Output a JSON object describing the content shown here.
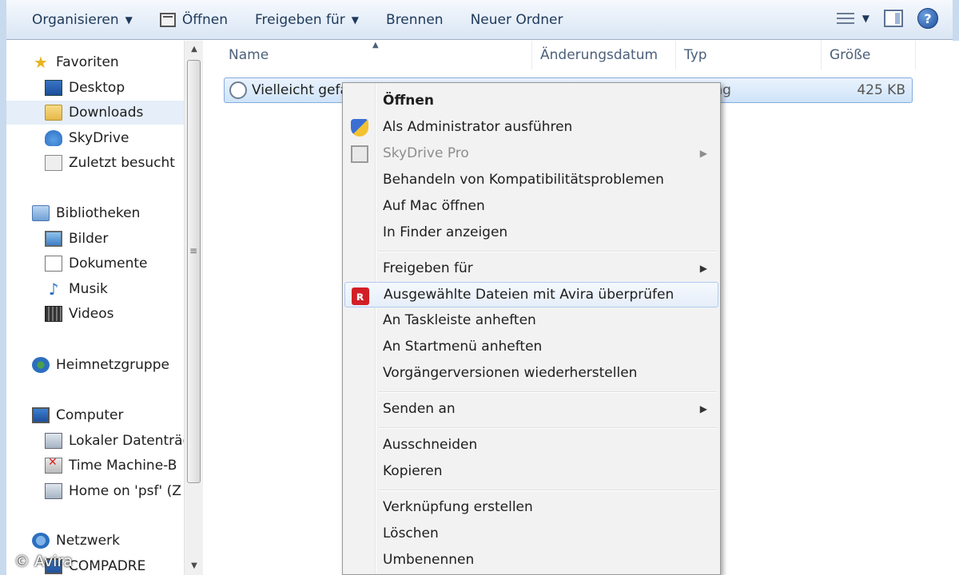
{
  "toolbar": {
    "organize": "Organisieren",
    "open": "Öffnen",
    "share": "Freigeben für",
    "burn": "Brennen",
    "new_folder": "Neuer Ordner",
    "help": "?"
  },
  "nav": {
    "favorites": "Favoriten",
    "desktop": "Desktop",
    "downloads": "Downloads",
    "skydrive": "SkyDrive",
    "recent": "Zuletzt besucht",
    "libraries": "Bibliotheken",
    "pictures": "Bilder",
    "documents": "Dokumente",
    "music": "Musik",
    "videos": "Videos",
    "homegroup": "Heimnetzgruppe",
    "computer": "Computer",
    "local_disk": "Lokaler Datenträg",
    "time_machine": "Time Machine-B",
    "home_psf": "Home on 'psf' (Z",
    "network": "Netzwerk",
    "compadre": "COMPADRE"
  },
  "columns": {
    "name": "Name",
    "date": "Änderungsdatum",
    "type": "Typ",
    "size": "Größe"
  },
  "file": {
    "name": "Vielleicht gefä",
    "type": "ndung",
    "size": "425 KB"
  },
  "menu": {
    "open": "Öffnen",
    "run_admin": "Als Administrator ausführen",
    "skydrive_pro": "SkyDrive Pro",
    "compat": "Behandeln von Kompatibilitätsproblemen",
    "open_mac": "Auf Mac öffnen",
    "show_finder": "In Finder anzeigen",
    "share_with": "Freigeben für",
    "avira_scan": "Ausgewählte Dateien mit Avira überprüfen",
    "pin_taskbar": "An Taskleiste anheften",
    "pin_start": "An Startmenü anheften",
    "restore_prev": "Vorgängerversionen wiederherstellen",
    "send_to": "Senden an",
    "cut": "Ausschneiden",
    "copy": "Kopieren",
    "create_shortcut": "Verknüpfung erstellen",
    "delete": "Löschen",
    "rename": "Umbenennen"
  },
  "watermark": "© Avira",
  "colors": {
    "avira_red": "#d21f26",
    "selection_blue": "#cfe3f9",
    "toolbar_text": "#1e395b"
  }
}
